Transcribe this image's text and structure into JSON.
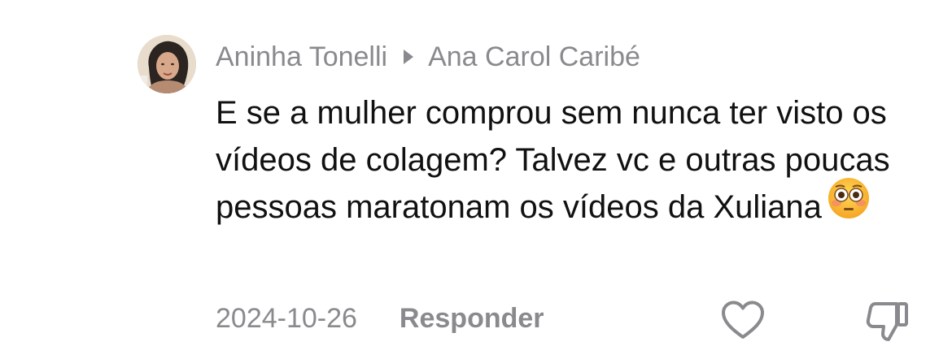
{
  "comment": {
    "author": "Aninha Tonelli",
    "reply_to": "Ana Carol Caribé",
    "text": "E se a mulher comprou sem nunca ter visto os vídeos de colagem? Talvez vc e outras poucas pessoas maratonam os vídeos da Xuliana",
    "emoji": "flushed-face",
    "date": "2024-10-26",
    "reply_label": "Responder"
  },
  "icons": {
    "avatar": "user-avatar-photo",
    "reply_to": "reply-arrow-icon",
    "like": "heart-outline-icon",
    "dislike": "thumbs-down-outline-icon"
  },
  "colors": {
    "meta_text": "#8a8a8e",
    "body_text": "#111111",
    "background": "#ffffff"
  }
}
